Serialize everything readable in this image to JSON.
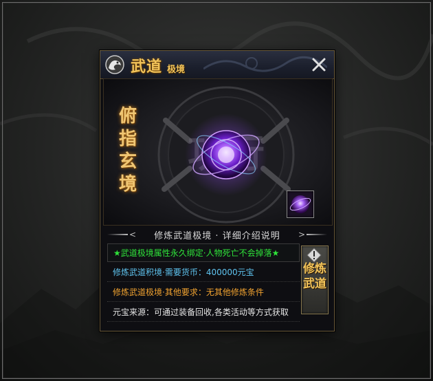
{
  "dialog": {
    "title_main": "武道",
    "title_sub": "极境",
    "close_icon": "close-icon",
    "dragon_icon": "dragon-emblem-icon"
  },
  "art": {
    "skill_name": "俯指玄境",
    "background_glyphs": "功行"
  },
  "item_slot": {
    "icon": "purple-orb-icon"
  },
  "section_header": "修炼武道极境 · 详细介绍说明",
  "info": {
    "line1": "★武道极境属性永久绑定·人物死亡不会掉落★",
    "line2": "修炼武道积境·需要货币：400000元宝",
    "line3": "修炼武道极境·其他要求：无其他修炼条件",
    "line4": "元宝来源：可通过装备回收,各类活动等方式获取"
  },
  "cultivate_button": {
    "label": "修炼武道",
    "icon": "exclamation-warning-icon"
  },
  "colors": {
    "gold": "#f2c45a",
    "green": "#2fe33a",
    "cyan": "#5fc4f0",
    "orange": "#f0a230",
    "purple_orb": "#8a3cf0"
  }
}
